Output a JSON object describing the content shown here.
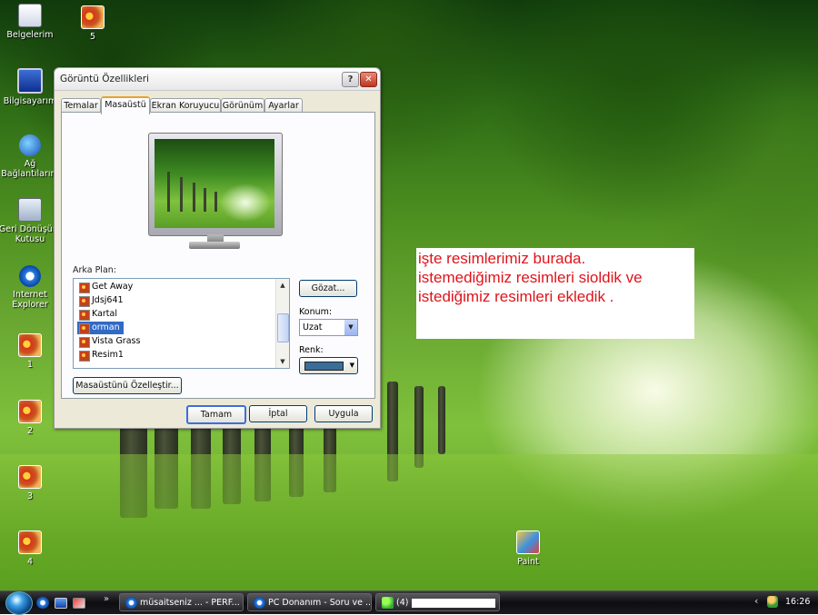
{
  "desktop": {
    "icons": [
      {
        "label": "Belgelerim"
      },
      {
        "label": "5"
      },
      {
        "label": "Bilgisayarım"
      },
      {
        "label": "Ağ Bağlantılarım"
      },
      {
        "label": "Geri Dönüşüm Kutusu"
      },
      {
        "label": "Internet Explorer"
      },
      {
        "label": "1"
      },
      {
        "label": "2"
      },
      {
        "label": "3"
      },
      {
        "label": "4"
      },
      {
        "label": "Paint"
      }
    ],
    "note_lines": [
      "işte resimlerimiz burada.",
      "istemediğimiz resimleri sioldik ve",
      "istediğimiz resimleri ekledik ."
    ]
  },
  "dialog": {
    "title": "Görüntü Özellikleri",
    "help_label": "?",
    "close_label": "✕",
    "tabs": [
      {
        "label": "Temalar"
      },
      {
        "label": "Masaüstü",
        "selected": true
      },
      {
        "label": "Ekran Koruyucu"
      },
      {
        "label": "Görünüm"
      },
      {
        "label": "Ayarlar"
      }
    ],
    "background_label": "Arka Plan:",
    "backgrounds": [
      "Get Away",
      "Jdsj641",
      "Kartal",
      "orman",
      "Vista Grass",
      "Resim1"
    ],
    "selected_background": "orman",
    "browse_label": "Gözat...",
    "position_label": "Konum:",
    "position_value": "Uzat",
    "color_label": "Renk:",
    "color_value": "#3a6e9a",
    "customize_label": "Masaüstünü Özelleştir...",
    "ok_label": "Tamam",
    "cancel_label": "İptal",
    "apply_label": "Uygula"
  },
  "taskbar": {
    "quicklaunch_more": "»",
    "tasks": [
      {
        "label": "müsaitseniz ... - PERF...",
        "icon": "ie-icon"
      },
      {
        "label": "PC Donanım - Soru ve ...",
        "icon": "ie-icon"
      },
      {
        "label": "(4)",
        "icon": "msn-icon"
      }
    ],
    "tray_arrow": "‹",
    "clock": "16:26"
  },
  "colors": {
    "note_text": "#e0141a",
    "selection": "#316ac5",
    "dialog_face": "#ece9d8"
  }
}
